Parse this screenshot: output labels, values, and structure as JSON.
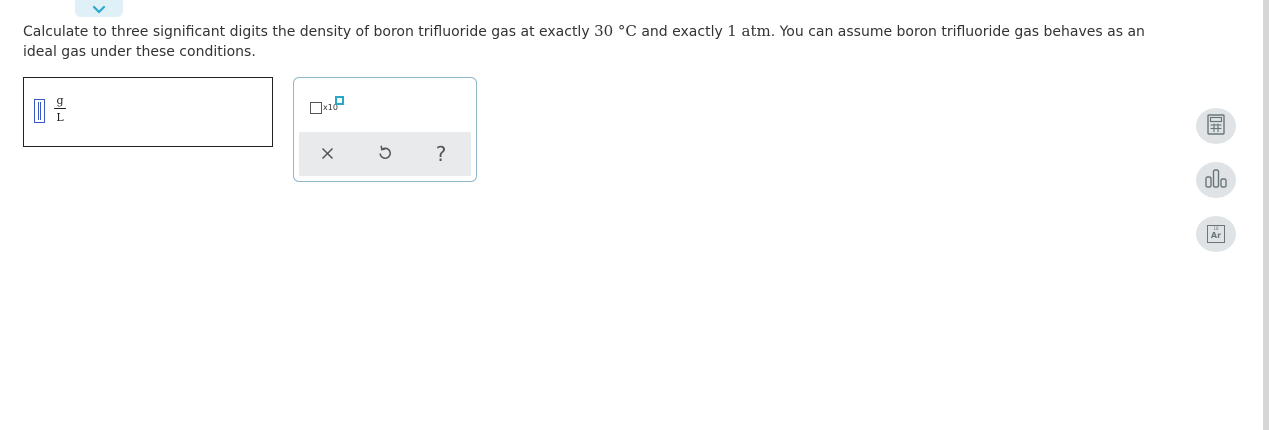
{
  "question": {
    "part1": "Calculate to three significant digits the density of boron trifluoride gas at exactly ",
    "temp_value": "30",
    "temp_unit": " °C",
    "part2": " and exactly ",
    "pressure_value": "1",
    "pressure_unit": " atm",
    "part3": ". You can assume boron trifluoride gas behaves as an ideal gas under these conditions."
  },
  "answer": {
    "unit_numerator": "g",
    "unit_denominator": "L"
  },
  "palette": {
    "sci_notation_label": "x10",
    "clear_icon": "close-icon",
    "undo_icon": "undo-icon",
    "help_label": "?"
  },
  "tools": [
    {
      "name": "calculator",
      "icon": "calculator-icon"
    },
    {
      "name": "data",
      "icon": "bar-chart-icon"
    },
    {
      "name": "periodic-table",
      "icon": "periodic-table-icon",
      "label": "Ar",
      "number": "18"
    }
  ],
  "colors": {
    "accent": "#29a9c9",
    "palette_border": "#8fb8cc",
    "tool_bg": "#dfe3e5",
    "cursor": "#3a5bbd"
  }
}
